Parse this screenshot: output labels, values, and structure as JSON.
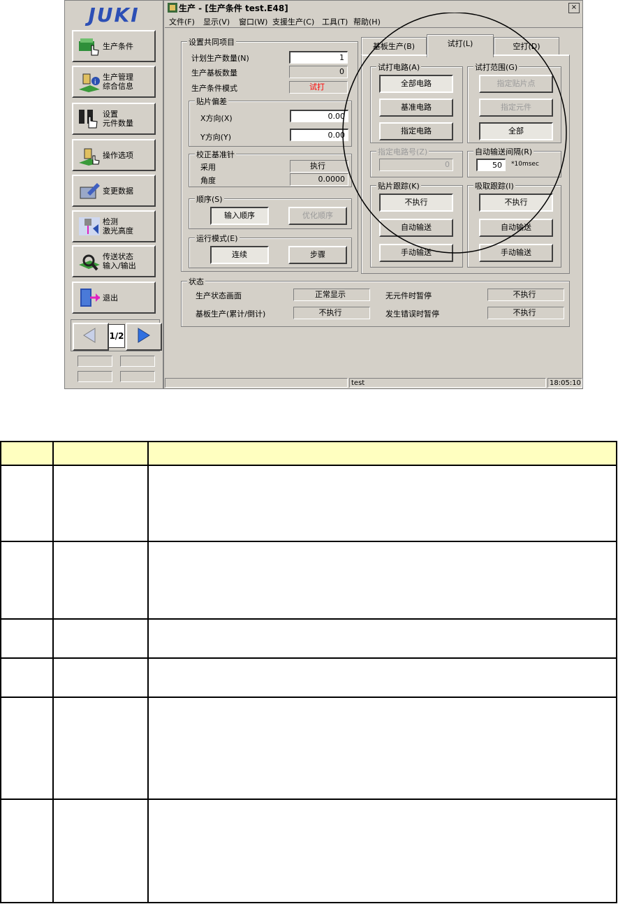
{
  "window": {
    "title": "生产 - [生产条件 test.E48]",
    "close_label": "×"
  },
  "logo": "JUKI",
  "menu": [
    "文件(F)",
    "显示(V)",
    "窗口(W)",
    "支援生产(C)",
    "工具(T)",
    "帮助(H)"
  ],
  "nav": [
    {
      "label": "生产条件",
      "icon": "hand-pointer-icon"
    },
    {
      "label": "生产管理\n综合信息",
      "icon": "info-icon"
    },
    {
      "label": "设置\n元件数量",
      "icon": "hand-pointer-icon"
    },
    {
      "label": "操作选项",
      "icon": "operator-icon"
    },
    {
      "label": "变更数据",
      "icon": "edit-icon"
    },
    {
      "label": "检测\n激光高度",
      "icon": "laser-icon"
    },
    {
      "label": "传送状态\n输入/输出",
      "icon": "magnifier-icon"
    },
    {
      "label": "退出",
      "icon": "exit-door-icon"
    }
  ],
  "pager": {
    "page": "1/2"
  },
  "common": {
    "group_label": "设置共同项目",
    "plan_qty_label": "计划生产数量(N)",
    "plan_qty_value": "1",
    "board_qty_label": "生产基板数量",
    "board_qty_value": "0",
    "mode_label": "生产条件模式",
    "mode_value": "试打"
  },
  "offset": {
    "group_label": "贴片偏差",
    "x_label": "X方向(X)",
    "x_value": "0.00",
    "y_label": "Y方向(Y)",
    "y_value": "0.00"
  },
  "calib": {
    "group_label": "校正基准针",
    "use_label": "采用",
    "use_value": "执行",
    "angle_label": "角度",
    "angle_value": "0.0000"
  },
  "order": {
    "group_label": "顺序(S)",
    "input_btn": "输入顺序",
    "opt_btn": "优化顺序"
  },
  "runmode": {
    "group_label": "运行模式(E)",
    "continuous_btn": "连续",
    "step_btn": "步骤"
  },
  "tabs": [
    "基板生产(B)",
    "试打(L)",
    "空打(D)"
  ],
  "trial_circuit": {
    "group_label": "试打电路(A)",
    "all_btn": "全部电路",
    "base_btn": "基准电路",
    "spec_btn": "指定电路"
  },
  "trial_range": {
    "group_label": "试打范围(G)",
    "point_btn": "指定贴片点",
    "part_btn": "指定元件",
    "all_btn": "全部"
  },
  "circuit_no": {
    "group_label": "指定电路号(Z)",
    "value": "0"
  },
  "auto_interval": {
    "group_label": "自动输送间隔(R)",
    "value": "50",
    "unit": "*10msec"
  },
  "mount_track": {
    "group_label": "贴片跟踪(K)",
    "none_btn": "不执行",
    "auto_btn": "自动输送",
    "manual_btn": "手动输送"
  },
  "pick_track": {
    "group_label": "吸取跟踪(I)",
    "none_btn": "不执行",
    "auto_btn": "自动输送",
    "manual_btn": "手动输送"
  },
  "status": {
    "group_label": "状态",
    "screen_label": "生产状态画面",
    "screen_value": "正常显示",
    "nopart_label": "无元件时暂停",
    "nopart_value": "不执行",
    "board_label": "基板生产(累计/倒计)",
    "board_value": "不执行",
    "error_label": "发生错误时暂停",
    "error_value": "不执行"
  },
  "statusbar": {
    "file": "test",
    "time": "18:05:10"
  },
  "colors": {
    "face": "#d4d0c8",
    "header": "#ffffc0",
    "accent_red": "#ff0000",
    "logo_blue": "#2c4fb5"
  }
}
